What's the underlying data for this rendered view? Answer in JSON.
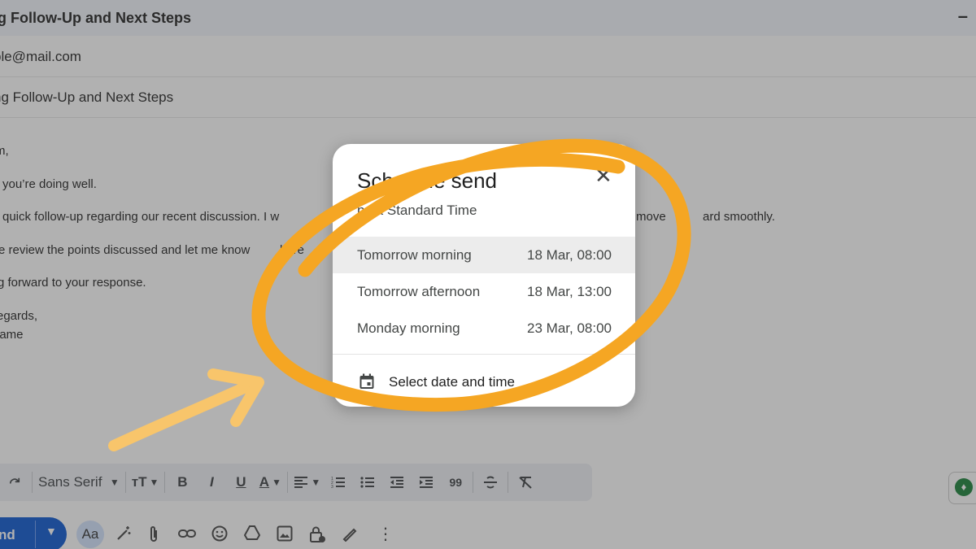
{
  "compose": {
    "window_title": "ng Follow-Up and Next Steps",
    "minimize_glyph": "–",
    "to_value": "ple@mail.com",
    "subject_value": "ng Follow-Up and Next Steps",
    "body_lines": [
      "m,",
      "you’re doing well.",
      "quick follow-up regarding our recent discussion. I w",
      "e review the points discussed and let me know",
      "g forward to your response.",
      "egards,",
      "lame"
    ],
    "body_right_fragment": "move",
    "body_right_fragment2": "ard smoothly.",
    "body_mid_fragment": "here"
  },
  "format_toolbar": {
    "redo_icon": "redo-icon",
    "font": "Sans Serif",
    "size_glyph": "тT",
    "bold": "B",
    "italic": "I",
    "underline": "U",
    "text_color": "A",
    "quote": "99"
  },
  "actions": {
    "send_label": "nd",
    "aa_label": "Aa"
  },
  "dialog": {
    "title": "Schedule send",
    "timezone": "ndia Standard Time",
    "options": [
      {
        "label": "Tomorrow morning",
        "time": "18 Mar, 08:00",
        "highlighted": true
      },
      {
        "label": "Tomorrow afternoon",
        "time": "18 Mar, 13:00",
        "highlighted": false
      },
      {
        "label": "Monday morning",
        "time": "23 Mar, 08:00",
        "highlighted": false
      }
    ],
    "pick_label": "Select date and time"
  },
  "colors": {
    "accent_blue": "#0b57d0",
    "annotation_orange": "#f5a623",
    "highlight_row": "#ececec"
  }
}
